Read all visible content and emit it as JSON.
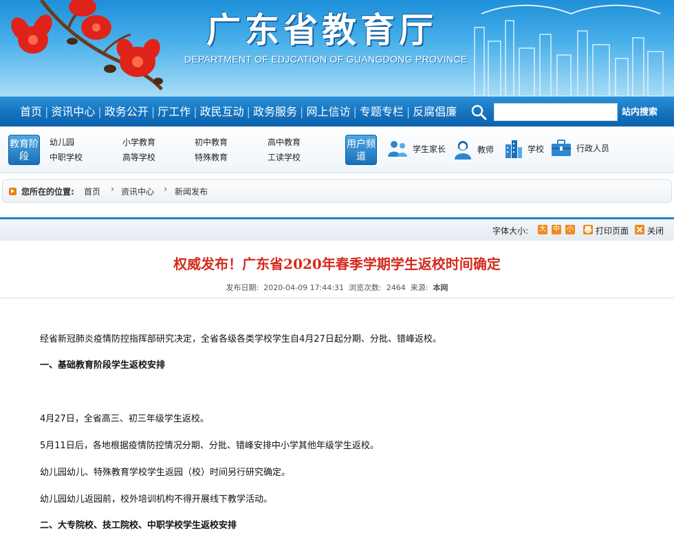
{
  "banner": {
    "title": "广东省教育厅",
    "subtitle": "DEPARTMENT OF EDJCATION OF GUANGDONG PROVINCE"
  },
  "mainnav": {
    "items": [
      "首页",
      "资讯中心",
      "政务公开",
      "厅工作",
      "政民互动",
      "政务服务",
      "网上信访",
      "专题专栏",
      "反腐倡廉"
    ],
    "search_button": "站内搜索",
    "search_placeholder": ""
  },
  "subnav": {
    "stage_tag": "教育阶段",
    "stages": [
      "幼儿园",
      "小学教育",
      "初中教育",
      "高中教育",
      "中职学校",
      "高等学校",
      "特殊教育",
      "工读学校"
    ],
    "user_tag": "用户频道",
    "users": [
      {
        "label": "学生家长",
        "icon": "parents-icon"
      },
      {
        "label": "教师",
        "icon": "teacher-icon"
      },
      {
        "label": "学校",
        "icon": "school-icon"
      },
      {
        "label": "行政人员",
        "icon": "briefcase-icon"
      }
    ]
  },
  "breadcrumb": {
    "label": "您所在的位置:",
    "items": [
      "首页",
      "资讯中心",
      "新闻发布"
    ]
  },
  "toolbar": {
    "font_size_label": "字体大小:",
    "sizes": [
      "大",
      "中",
      "小"
    ],
    "print": "打印页面",
    "close": "关闭"
  },
  "article": {
    "title": "权威发布！广东省2020年春季学期学生返校时间确定",
    "date_label": "发布日期:",
    "date": "2020-04-09 17:44:31",
    "views_label": "浏览次数:",
    "views": "2464",
    "source_label": "来源:",
    "source": "本网",
    "paragraphs": [
      "经省新冠肺炎疫情防控指挥部研究决定，全省各级各类学校学生自4月27日起分期、分批、错峰返校。",
      "一、基础教育阶段学生返校安排",
      "4月27日，全省高三、初三年级学生返校。",
      "5月11日后，各地根据疫情防控情况分期、分批、错峰安排中小学其他年级学生返校。",
      "幼儿园幼儿、特殊教育学校学生返园（校）时间另行研究确定。",
      "幼儿园幼儿返园前，校外培训机构不得开展线下教学活动。",
      "二、大专院校、技工院校、中职学校学生返校安排"
    ]
  },
  "colors": {
    "nav_blue": "#1472bf",
    "title_red": "#d42a1e",
    "accent_orange": "#ef8a1c"
  }
}
